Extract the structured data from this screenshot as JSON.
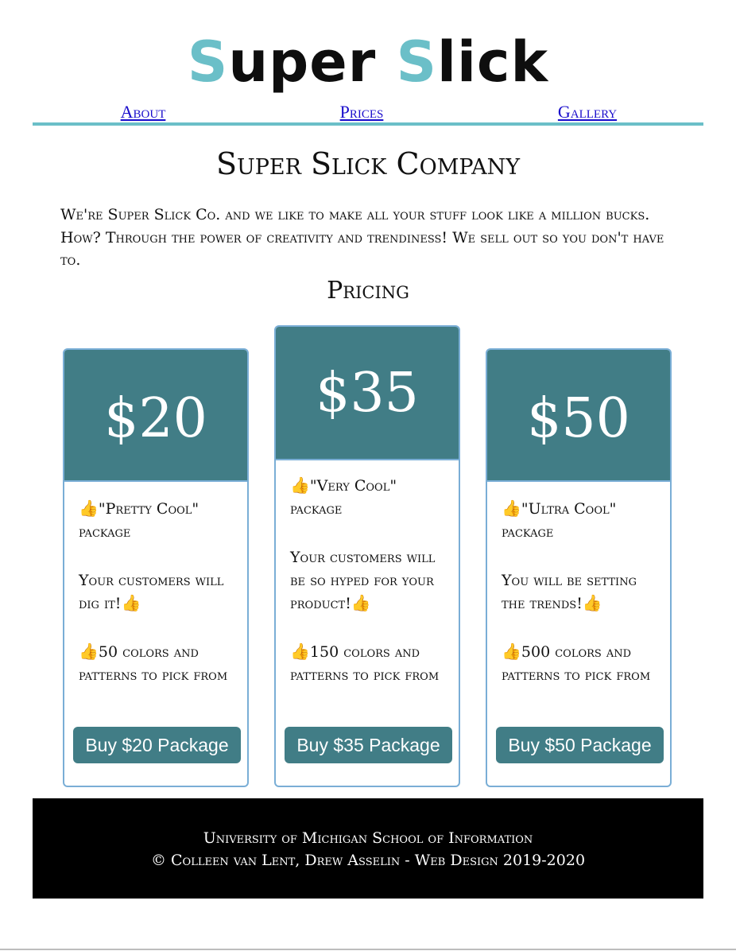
{
  "logo": {
    "s1": "S",
    "p1": "uper ",
    "s2": "S",
    "p2": "lick",
    "accent_color": "#6bbfc8"
  },
  "nav": {
    "items": [
      {
        "label": "About"
      },
      {
        "label": "Prices"
      },
      {
        "label": "Gallery"
      }
    ]
  },
  "page_title": "Super Slick Company",
  "intro": "We're Super Slick Co. and we like to make all your stuff look like a million bucks. How? Through the power of creativity and trendiness! We sell out so you don't have to.",
  "pricing_title": "Pricing",
  "cards": [
    {
      "price": "$20",
      "package": "\"Pretty Cool\" package",
      "desc": "Your customers will dig it!",
      "colors": "50 colors and patterns to pick from",
      "button": "Buy $20 Package"
    },
    {
      "price": "$35",
      "package": "\"Very Cool\" package",
      "desc": "Your customers will be so hyped for your product!",
      "colors": "150 colors and patterns to pick from",
      "button": "Buy $35 Package"
    },
    {
      "price": "$50",
      "package": "\"Ultra Cool\" package",
      "desc": "You will be setting the trends!",
      "colors": "500 colors and patterns to pick from",
      "button": "Buy $50 Package"
    }
  ],
  "thumb_icon": "👍",
  "footer": {
    "line1": "University of Michigan School of Information",
    "line2": "© Colleen van Lent, Drew Asselin - Web Design 2019-2020"
  },
  "colors": {
    "teal": "#417d86",
    "accent": "#6bbfc8",
    "card_border": "#7aaed6"
  }
}
